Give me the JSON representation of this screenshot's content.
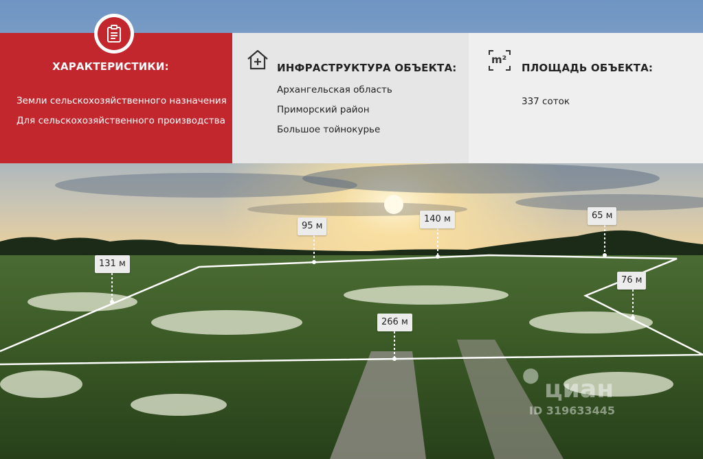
{
  "characteristics": {
    "title": "ХАРАКТЕРИСТИКИ:",
    "items": [
      "Земли сельскохозяйственного назначения",
      "Для сельскохозяйственного производства"
    ]
  },
  "infrastructure": {
    "title": "ИНФРАСТРУКТУРА ОБЪЕКТА:",
    "items": [
      "Архангельская область",
      "Приморский район",
      "Большое тойнокурье"
    ]
  },
  "area": {
    "title": "ПЛОЩАДЬ ОБЪЕКТА:",
    "value": "337 соток",
    "icon_label": "m²"
  },
  "dimensions": [
    "131 м",
    "95 м",
    "140 м",
    "65 м",
    "76 м",
    "266 м"
  ],
  "watermark": {
    "brand": "циан",
    "id": "ID 319633445"
  },
  "colors": {
    "accent": "#c1272d",
    "panel": "#e6e6e6"
  }
}
